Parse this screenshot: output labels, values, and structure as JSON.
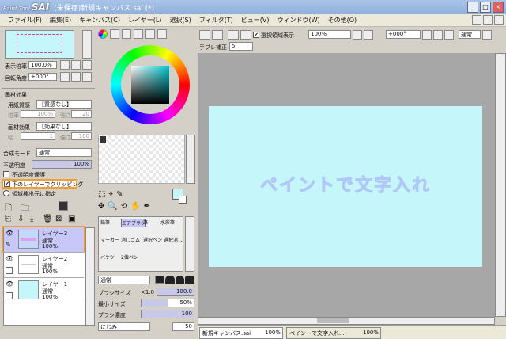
{
  "titlebar": {
    "logo_small": "Paint Tool",
    "logo": "SAI",
    "title": "(未保存)新規キャンバス.sai (*)",
    "min": "_",
    "max": "□",
    "close": "×"
  },
  "menu": [
    "ファイル(F)",
    "編集(E)",
    "キャンバス(C)",
    "レイヤー(L)",
    "選択(S)",
    "フィルタ(T)",
    "ビュー(V)",
    "ウィンドウ(W)",
    "その他(O)"
  ],
  "nav": {
    "zoom_label": "表示倍率",
    "zoom_value": "100.0%",
    "rot_label": "回転角度",
    "rot_value": "+000°"
  },
  "paper": {
    "header": "画材効果",
    "texture_label": "用紙質感",
    "texture_value": "【質感なし】",
    "texture_scale_label": "倍率",
    "texture_scale": "100%",
    "texture_strength_label": "強さ",
    "texture_strength": "20",
    "effect_label": "画材効果",
    "effect_value": "【効果なし】",
    "effect_width_label": "幅",
    "effect_width": "1",
    "effect_strength_label": "強さ",
    "effect_strength": "100"
  },
  "layerprops": {
    "blend_label": "合成モード",
    "blend_value": "通常",
    "opacity_label": "不透明度",
    "opacity_value": "100%",
    "lock_opacity": "不透明度保護",
    "clip": "下のレイヤーでクリッピング",
    "select_src": "領域検出元に指定"
  },
  "layers": [
    {
      "name": "レイヤー3",
      "mode": "通常",
      "opacity": "100%"
    },
    {
      "name": "レイヤー2",
      "mode": "通常",
      "opacity": "100%"
    },
    {
      "name": "レイヤー1",
      "mode": "通常",
      "opacity": "100%"
    }
  ],
  "tools": {
    "row1": [
      "鉛筆",
      "エアブラシ",
      "筆",
      "水彩筆"
    ],
    "row2": [
      "マーカー",
      "消しゴム",
      "選択ペン",
      "選択消し"
    ],
    "row3": [
      "バケツ",
      "2値ペン"
    ]
  },
  "brush": {
    "mode": "通常",
    "size_label": "ブラシサイズ",
    "size_mult": "×1.0",
    "size_value": "100.0",
    "min_label": "最小サイズ",
    "min_value": "50%",
    "density_label": "ブラシ濃度",
    "density_value": "100",
    "blend_label": "にじみ",
    "blend_value": "50"
  },
  "toolbar": {
    "select_show": "選択領域表示",
    "zoom": "100%",
    "angle": "+000°",
    "mode": "通常",
    "stab_label": "手ブレ補正",
    "stab_value": "5"
  },
  "canvas": {
    "text": "ペイントで文字入れ"
  },
  "status": {
    "tab1": "新規キャンバス.sai",
    "tab1_zoom": "100%",
    "tab2": "ペイントで文字入れ...",
    "tab2_zoom": "100%"
  },
  "colors": {
    "accent_orange": "#f0a030",
    "paper": "#c4f6fa",
    "layer_selected": "#c8c8f8"
  }
}
